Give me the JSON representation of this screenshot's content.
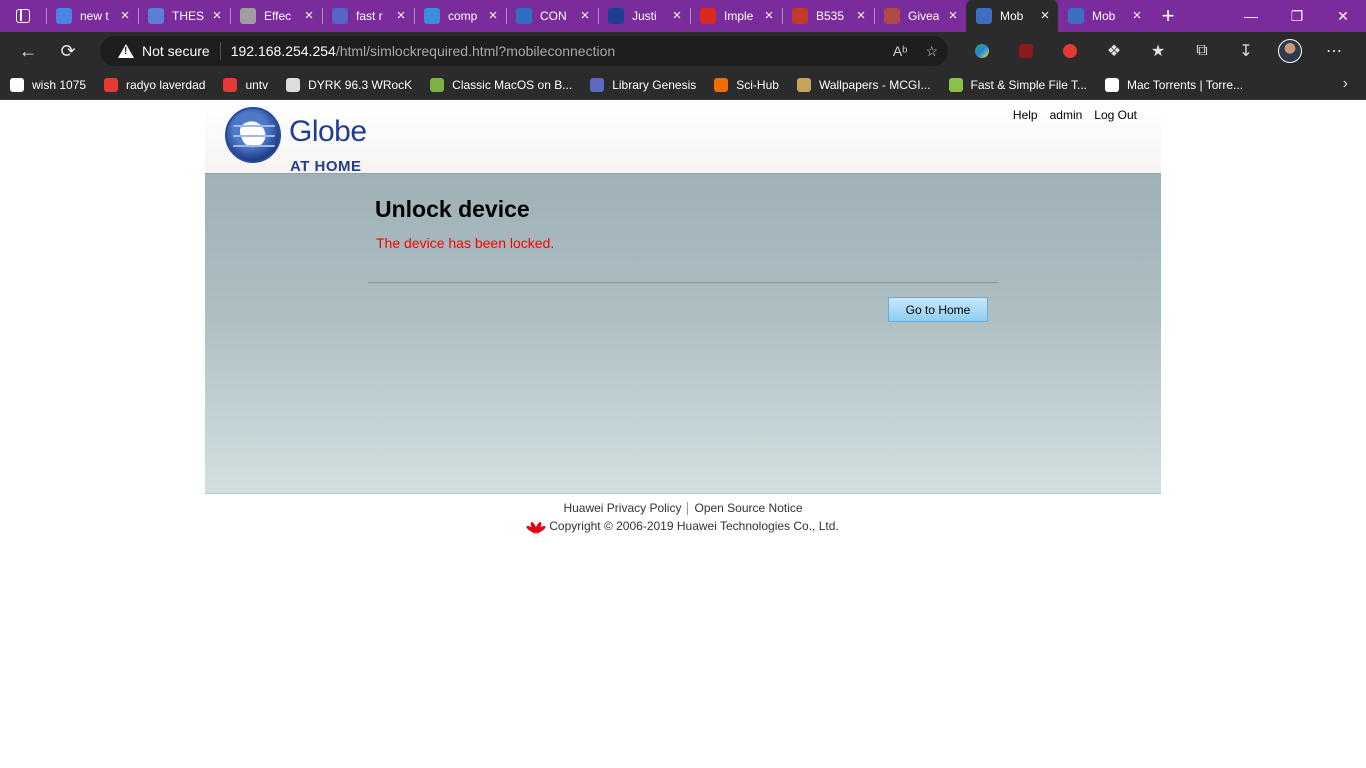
{
  "browser": {
    "tabs": [
      {
        "title": "new t",
        "fav_color": "#4a86e8"
      },
      {
        "title": "THES",
        "fav_color": "#5b7fd6"
      },
      {
        "title": "Effec",
        "fav_color": "#9e9e9e"
      },
      {
        "title": "fast r",
        "fav_color": "#5964c9"
      },
      {
        "title": "comp",
        "fav_color": "#3d8fd8"
      },
      {
        "title": "CON",
        "fav_color": "#2f6fc2"
      },
      {
        "title": "Justi",
        "fav_color": "#1c3f94"
      },
      {
        "title": "Imple",
        "fav_color": "#d9281c"
      },
      {
        "title": "B535",
        "fav_color": "#c0392b"
      },
      {
        "title": "Givea",
        "fav_color": "#b04a4a"
      },
      {
        "title": "Mob",
        "fav_color": "#3b6fc4"
      },
      {
        "title": "Mob",
        "fav_color": "#3b6fc4"
      }
    ],
    "active_tab_index": 10,
    "address": {
      "security_label": "Not secure",
      "host": "192.168.254.254",
      "path": "/html/simlockrequired.html?mobileconnection"
    },
    "bookmarks": [
      {
        "label": "wish 1075",
        "fav_color": "#ffffff"
      },
      {
        "label": "radyo laverdad",
        "fav_color": "#e53935"
      },
      {
        "label": "untv",
        "fav_color": "#e53935"
      },
      {
        "label": "DYRK 96.3 WRocK",
        "fav_color": "#dddddd"
      },
      {
        "label": "Classic MacOS on B...",
        "fav_color": "#7cb342"
      },
      {
        "label": "Library Genesis",
        "fav_color": "#5c6bc0"
      },
      {
        "label": "Sci-Hub",
        "fav_color": "#ef6c00"
      },
      {
        "label": "Wallpapers - MCGI...",
        "fav_color": "#c8a25a"
      },
      {
        "label": "Fast & Simple File T...",
        "fav_color": "#8bc34a"
      },
      {
        "label": "Mac Torrents | Torre...",
        "fav_color": "#ffffff"
      }
    ]
  },
  "header": {
    "brand": "Globe",
    "brand_sub": "AT HOME",
    "links": {
      "help": "Help",
      "user": "admin",
      "logout": "Log Out"
    }
  },
  "main": {
    "title": "Unlock device",
    "message": "The device has been locked.",
    "home_button": "Go to Home"
  },
  "footer": {
    "privacy": "Huawei Privacy Policy",
    "opensource": "Open Source Notice",
    "copyright": "Copyright © 2006-2019 Huawei Technologies Co., Ltd."
  },
  "colors": {
    "accent_purple": "#7a2b9c",
    "error_red": "#ff0000",
    "brand_blue": "#1e3f91"
  }
}
